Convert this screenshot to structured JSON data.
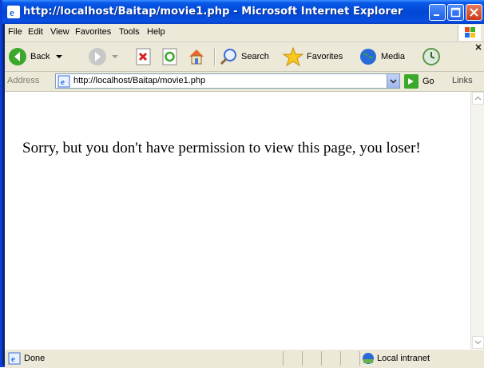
{
  "window": {
    "title": "http://localhost/Baitap/movie1.php - Microsoft Internet Explorer"
  },
  "menu": [
    {
      "label": "File"
    },
    {
      "label": "Edit"
    },
    {
      "label": "View"
    },
    {
      "label": "Favorites"
    },
    {
      "label": "Tools"
    },
    {
      "label": "Help"
    }
  ],
  "toolbar": {
    "back_label": "Back",
    "search_label": "Search",
    "favorites_label": "Favorites",
    "media_label": "Media"
  },
  "address": {
    "label": "Address",
    "url": "http://localhost/Baitap/movie1.php",
    "go_label": "Go",
    "links_label": "Links"
  },
  "page": {
    "message": "Sorry, but you don't have permission to view this page, you loser!"
  },
  "status": {
    "text": "Done",
    "zone": "Local intranet"
  },
  "colors": {
    "titlebar": "#0a58e8",
    "chrome": "#ece9d8"
  }
}
